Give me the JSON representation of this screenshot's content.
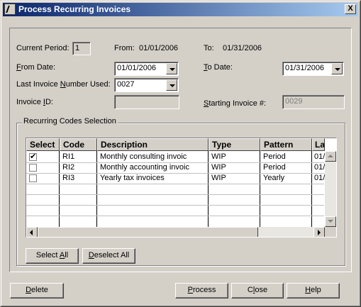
{
  "window": {
    "title": "Process Recurring Invoices",
    "close_label": "X"
  },
  "period": {
    "current_period_label": "Current Period:",
    "current_period_value": "1",
    "from_label": "From:",
    "from_value": "01/01/2006",
    "to_label": "To:",
    "to_value": "01/31/2006"
  },
  "form": {
    "from_date_prefix": "",
    "from_date_accel": "F",
    "from_date_rest": "rom Date:",
    "from_date_value": "01/01/2006",
    "to_date_accel": "T",
    "to_date_rest": "o Date:",
    "to_date_value": "01/31/2006",
    "last_invoice_prefix": "Last Invoice ",
    "last_invoice_accel": "N",
    "last_invoice_rest": "umber Used:",
    "last_invoice_value": "0027",
    "invoice_id_prefix": "Invoice ",
    "invoice_id_accel": "I",
    "invoice_id_rest": "D:",
    "invoice_id_value": "",
    "starting_invoice_accel": "S",
    "starting_invoice_rest": "tarting Invoice #:",
    "starting_invoice_value": "0029"
  },
  "recurring": {
    "group_title": "Recurring Codes Selection",
    "columns": [
      "Select",
      "Code",
      "Description",
      "Type",
      "Pattern",
      "La"
    ],
    "rows": [
      {
        "selected": true,
        "code": "RI1",
        "description": "Monthly consulting invoic",
        "type": "WIP",
        "pattern": "Period",
        "last": "01/"
      },
      {
        "selected": false,
        "code": "RI2",
        "description": "Monthly accounting invoic",
        "type": "WIP",
        "pattern": "Period",
        "last": "01/"
      },
      {
        "selected": false,
        "code": "RI3",
        "description": "Yearly tax invoices",
        "type": "WIP",
        "pattern": "Yearly",
        "last": "01/"
      }
    ],
    "select_all_prefix": "Select ",
    "select_all_accel": "A",
    "select_all_rest": "ll",
    "deselect_all_prefix": "",
    "deselect_all_accel": "D",
    "deselect_all_rest": "eselect All"
  },
  "footer": {
    "delete_accel": "D",
    "delete_rest": "elete",
    "process_accel": "P",
    "process_rest": "rocess",
    "close_prefix": "C",
    "close_accel": "l",
    "close_rest": "ose",
    "help_accel": "H",
    "help_rest": "elp"
  }
}
